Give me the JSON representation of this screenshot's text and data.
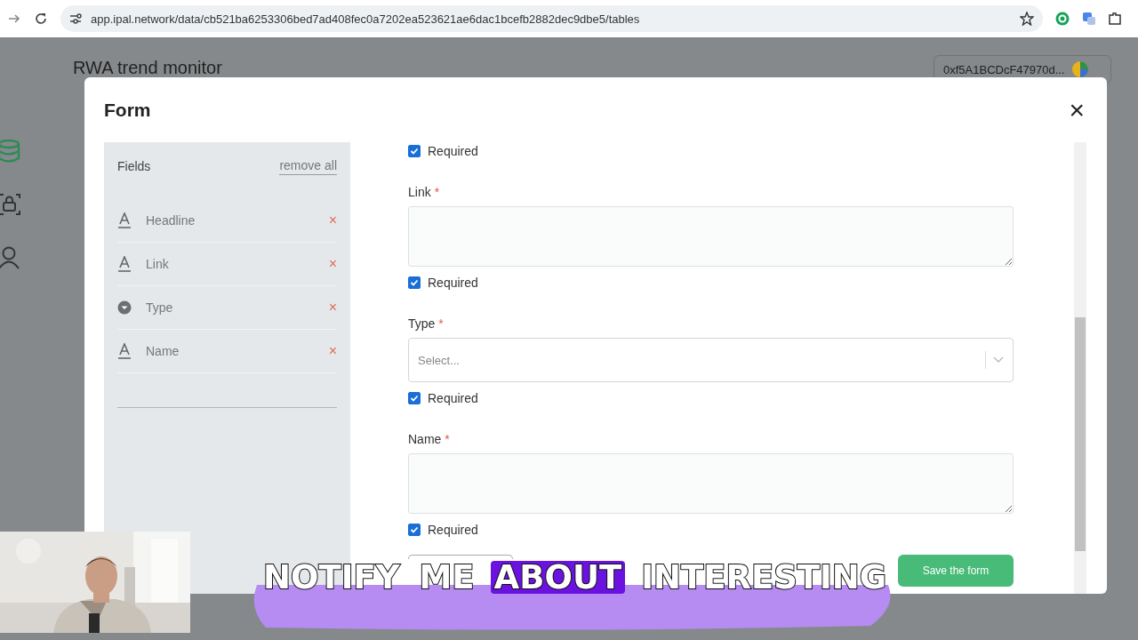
{
  "browser": {
    "url": "app.ipal.network/data/cb521ba6253306bed7ad408fec0a7202ea523621ae6dac1bcefb2882dec9dbe5/tables"
  },
  "app": {
    "title": "RWA trend monitor",
    "wallet": "0xf5A1BCDcF47970d..."
  },
  "modal": {
    "title": "Form",
    "close": "×",
    "sidebar": {
      "heading": "Fields",
      "remove_all": "remove all",
      "fields": [
        {
          "kind": "text",
          "label": "Headline",
          "remove": "×"
        },
        {
          "kind": "text",
          "label": "Link",
          "remove": "×"
        },
        {
          "kind": "select",
          "label": "Type",
          "remove": "×"
        },
        {
          "kind": "text",
          "label": "Name",
          "remove": "×"
        }
      ]
    },
    "form": {
      "items": [
        {
          "kind": "checkbox",
          "label": "Required",
          "checked": true
        },
        {
          "kind": "textarea",
          "label": "Link",
          "required_mark": "*"
        },
        {
          "kind": "checkbox",
          "label": "Required",
          "checked": true
        },
        {
          "kind": "select",
          "label": "Type",
          "required_mark": "*",
          "placeholder": "Select..."
        },
        {
          "kind": "checkbox",
          "label": "Required",
          "checked": true
        },
        {
          "kind": "textarea",
          "label": "Name",
          "required_mark": "*"
        },
        {
          "kind": "checkbox",
          "label": "Required",
          "checked": true
        }
      ],
      "save_button": "Save the form"
    }
  },
  "caption": {
    "words": [
      {
        "text": "NOTIFY",
        "highlighted": false
      },
      {
        "text": "ME",
        "highlighted": false
      },
      {
        "text": "ABOUT",
        "highlighted": true
      },
      {
        "text": "INTERESTING",
        "highlighted": false
      }
    ]
  }
}
